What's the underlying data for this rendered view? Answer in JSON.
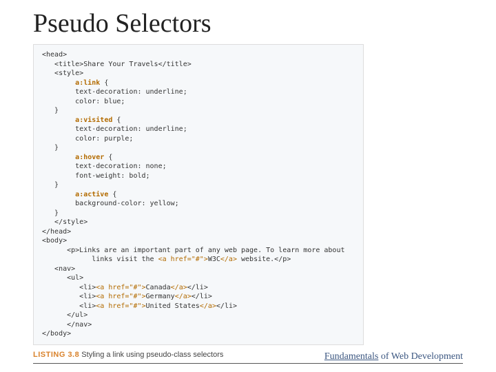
{
  "title": "Pseudo Selectors",
  "code": {
    "l01": "<head>",
    "l02": "   <title>Share Your Travels</title>",
    "l03": "   <style>",
    "l04_sel": "a:link",
    "l04_post": " {",
    "l05": "        text-decoration: underline;",
    "l06": "        color: blue;",
    "l07": "   }",
    "l08_sel": "a:visited",
    "l08_post": " {",
    "l09": "        text-decoration: underline;",
    "l10": "        color: purple;",
    "l11": "   }",
    "l12_sel": "a:hover",
    "l12_post": " {",
    "l13": "        text-decoration: none;",
    "l14": "        font-weight: bold;",
    "l15": "   }",
    "l16_sel": "a:active",
    "l16_post": " {",
    "l17": "        background-color: yellow;",
    "l18": "   }",
    "l19": "   </style>",
    "l20": "</head>",
    "l21": "<body>",
    "l22": "      <p>Links are an important part of any web page. To learn more about",
    "l23_pre": "            links visit the ",
    "l23_a": "<a href=\"#\">",
    "l23_mid": "W3C",
    "l23_aend": "</a>",
    "l23_post": " website.</p>",
    "l24": "   <nav>",
    "l25": "      <ul>",
    "l26_pre": "         <li>",
    "l26_a": "<a href=\"#\">",
    "l26_mid": "Canada",
    "l26_aend": "</a>",
    "l26_post": "</li>",
    "l27_pre": "         <li>",
    "l27_a": "<a href=\"#\">",
    "l27_mid": "Germany",
    "l27_aend": "</a>",
    "l27_post": "</li>",
    "l28_pre": "         <li>",
    "l28_a": "<a href=\"#\">",
    "l28_mid": "United States",
    "l28_aend": "</a>",
    "l28_post": "</li>",
    "l29": "      </ul>",
    "l30": "      </nav>",
    "l31": "</body>"
  },
  "caption": {
    "label": "LISTING 3.8",
    "text": " Styling a link using pseudo-class selectors"
  },
  "footer": {
    "word1": "Fundamentals",
    "word2": " of Web Development"
  }
}
